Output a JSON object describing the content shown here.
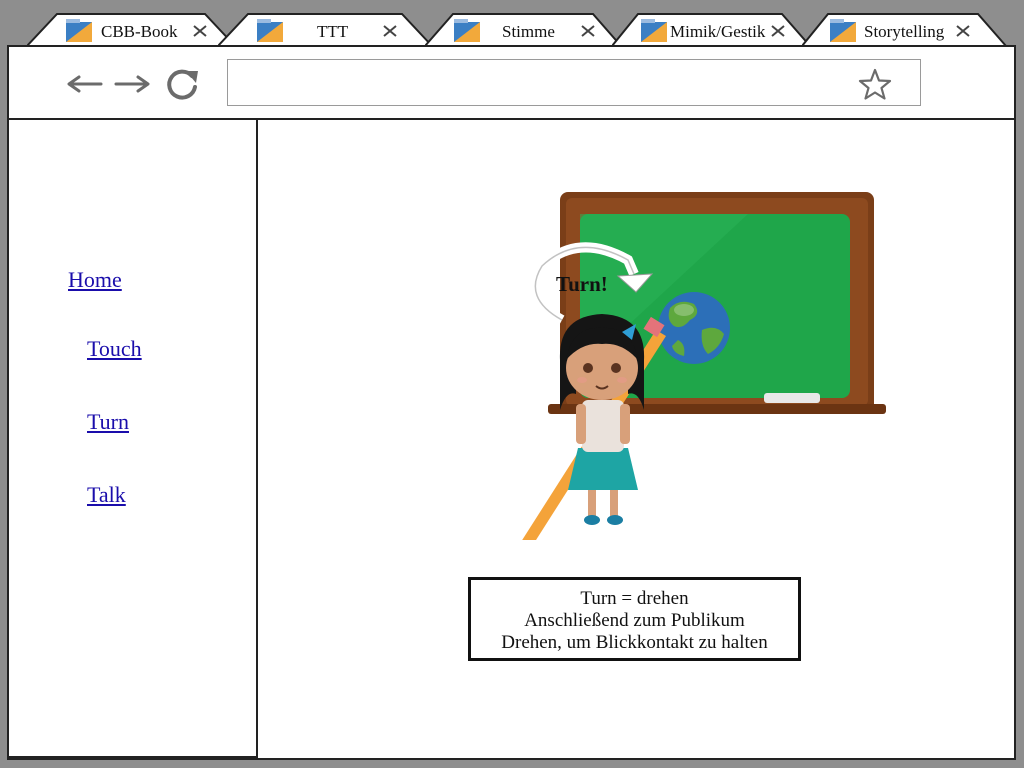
{
  "tabs": [
    {
      "label": "CBB-Book"
    },
    {
      "label": "TTT"
    },
    {
      "label": "Stimme"
    },
    {
      "label": "Mimik/Gestik"
    },
    {
      "label": "Storytelling"
    }
  ],
  "toolbar": {
    "address_value": "",
    "back_icon": "arrow-left-icon",
    "forward_icon": "arrow-right-icon",
    "reload_icon": "reload-icon",
    "bookmark_icon": "star-icon"
  },
  "sidebar": {
    "items": [
      {
        "label": "Home"
      },
      {
        "label": "Touch"
      },
      {
        "label": "Turn"
      },
      {
        "label": "Talk"
      }
    ]
  },
  "main": {
    "illustration_label": "Turn!",
    "caption": {
      "line1": "Turn = drehen",
      "line2": "Anschließend zum Publikum",
      "line3": "Drehen, um Blickkontakt zu halten"
    }
  },
  "colors": {
    "link": "#1a0dab",
    "chalkboard": "#1fa64a",
    "frame": "#7a3e18",
    "background": "#8e8e8e"
  }
}
